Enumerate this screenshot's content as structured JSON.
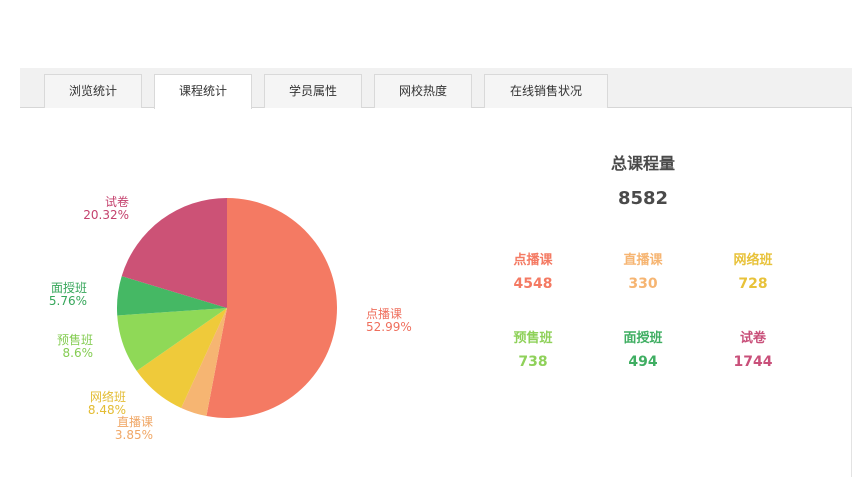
{
  "tabs": [
    {
      "label": "浏览统计",
      "active": false
    },
    {
      "label": "课程统计",
      "active": true
    },
    {
      "label": "学员属性",
      "active": false
    },
    {
      "label": "网校热度",
      "active": false
    },
    {
      "label": "在线销售状况",
      "active": false
    }
  ],
  "stats": {
    "title": "总课程量",
    "total": "8582",
    "items": [
      {
        "label": "点播课",
        "value": "4548",
        "color": "#f47a63"
      },
      {
        "label": "直播课",
        "value": "330",
        "color": "#f6b572"
      },
      {
        "label": "网络班",
        "value": "728",
        "color": "#e8c23a"
      },
      {
        "label": "预售班",
        "value": "738",
        "color": "#8fd15a"
      },
      {
        "label": "面授班",
        "value": "494",
        "color": "#3fae62"
      },
      {
        "label": "试卷",
        "value": "1744",
        "color": "#c9507a"
      }
    ]
  },
  "chart_data": {
    "type": "pie",
    "categories": [
      "点播课",
      "直播课",
      "网络班",
      "预售班",
      "面授班",
      "试卷"
    ],
    "values": [
      4548,
      330,
      728,
      738,
      494,
      1744
    ],
    "percent_labels": [
      "52.99%",
      "3.85%",
      "8.48%",
      "8.6%",
      "5.76%",
      "20.32%"
    ],
    "colors": [
      "#f47a63",
      "#f6b572",
      "#efca3a",
      "#8fd957",
      "#45b864",
      "#cc5276"
    ],
    "label_colors": [
      "#ef6f5d",
      "#f0a766",
      "#e3bc33",
      "#84cc52",
      "#36a65a",
      "#c4416d"
    ]
  }
}
